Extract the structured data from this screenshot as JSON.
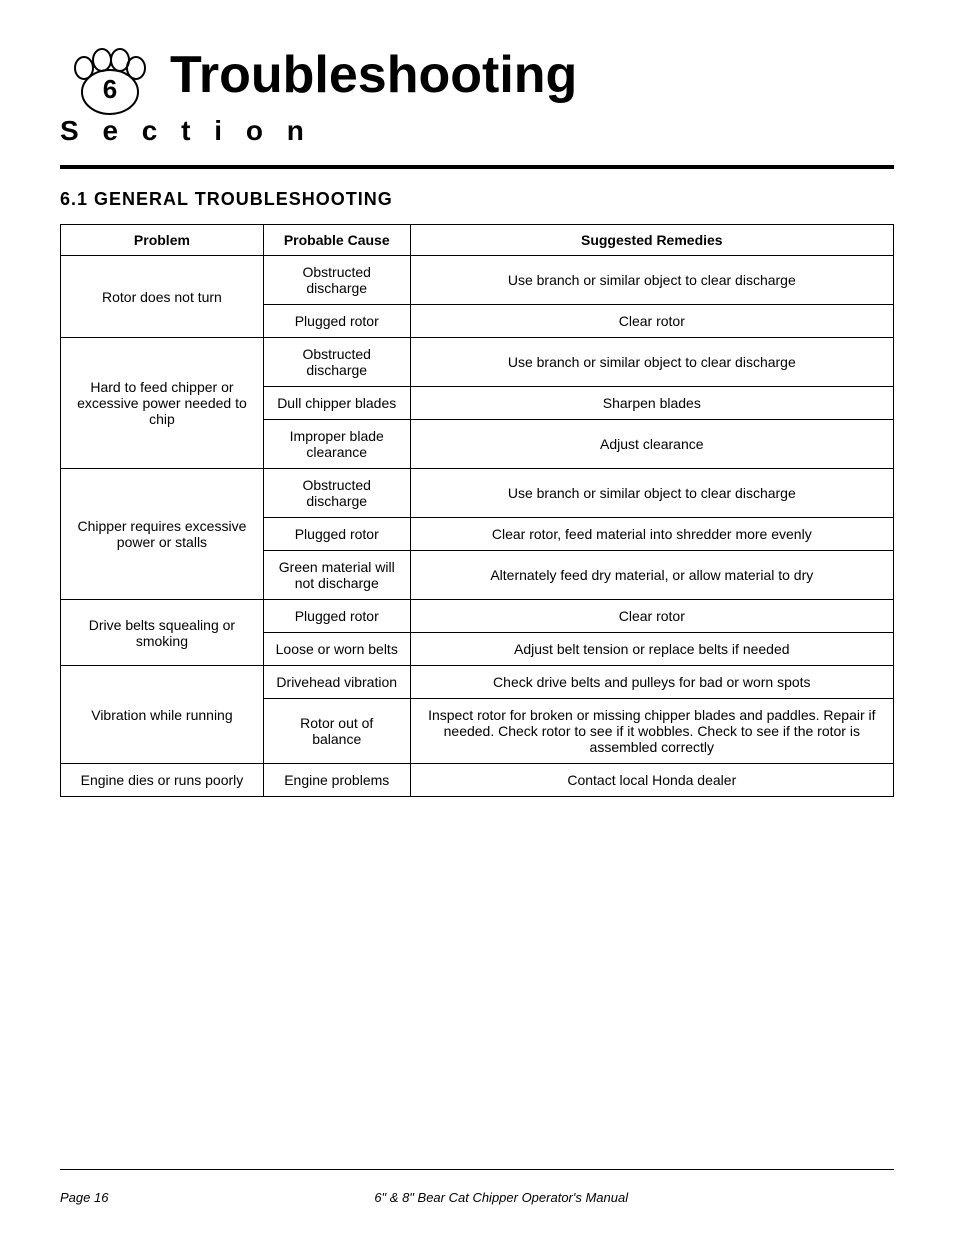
{
  "header": {
    "section_number": "6",
    "title": "Troubleshooting",
    "section_label": "S e c t i o n"
  },
  "subsection": {
    "number": "6.1",
    "title": "GENERAL  TROUBLESHOOTING"
  },
  "table": {
    "headers": [
      "Problem",
      "Probable Cause",
      "Suggested Remedies"
    ],
    "rows": [
      {
        "problem": "Rotor does not turn",
        "problem_rowspan": 2,
        "causes": [
          {
            "cause": "Obstructed discharge",
            "remedy": "Use branch or similar object to clear discharge"
          },
          {
            "cause": "Plugged rotor",
            "remedy": "Clear rotor"
          }
        ]
      },
      {
        "problem": "Hard to feed chipper or excessive power needed to chip",
        "problem_rowspan": 3,
        "causes": [
          {
            "cause": "Obstructed discharge",
            "remedy": "Use branch or similar object to clear discharge"
          },
          {
            "cause": "Dull chipper blades",
            "remedy": "Sharpen blades"
          },
          {
            "cause": "Improper blade clearance",
            "remedy": "Adjust clearance"
          }
        ]
      },
      {
        "problem": "Chipper requires excessive power or stalls",
        "problem_rowspan": 3,
        "causes": [
          {
            "cause": "Obstructed discharge",
            "remedy": "Use branch or similar object to clear discharge"
          },
          {
            "cause": "Plugged rotor",
            "remedy": "Clear rotor, feed material into shredder more evenly"
          },
          {
            "cause": "Green material will not discharge",
            "remedy": "Alternately feed dry material, or allow material to dry"
          }
        ]
      },
      {
        "problem": "Drive belts squealing or smoking",
        "problem_rowspan": 2,
        "causes": [
          {
            "cause": "Plugged rotor",
            "remedy": "Clear rotor"
          },
          {
            "cause": "Loose or worn belts",
            "remedy": "Adjust belt tension or replace belts if needed"
          }
        ]
      },
      {
        "problem": "Vibration while running",
        "problem_rowspan": 2,
        "causes": [
          {
            "cause": "Drivehead vibration",
            "remedy": "Check drive belts and pulleys for bad or worn spots"
          },
          {
            "cause": "Rotor out of balance",
            "remedy": "Inspect rotor for broken or missing chipper blades and paddles. Repair if needed. Check rotor to see if it wobbles. Check to see if the rotor is assembled correctly"
          }
        ]
      },
      {
        "problem": "Engine dies or runs poorly",
        "problem_rowspan": 1,
        "causes": [
          {
            "cause": "Engine problems",
            "remedy": "Contact local Honda dealer"
          }
        ]
      }
    ]
  },
  "footer": {
    "left": "Page 16",
    "center": "6\" & 8\" Bear Cat Chipper Operator's Manual",
    "right": ""
  }
}
